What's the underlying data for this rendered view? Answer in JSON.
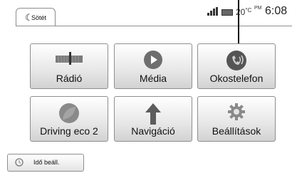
{
  "status_bar": {
    "mode_label": "Sötét",
    "temperature": "20",
    "temperature_unit": "°C",
    "ampm": "PM",
    "time": "6:08"
  },
  "tiles": [
    {
      "label": "Rádió",
      "icon": "radio-icon"
    },
    {
      "label": "Média",
      "icon": "media-play-icon"
    },
    {
      "label": "Okostelefon",
      "icon": "smartphone-icon"
    },
    {
      "label": "Driving eco 2",
      "icon": "eco-leaf-icon"
    },
    {
      "label": "Navigáció",
      "icon": "navigation-arrow-icon"
    },
    {
      "label": "Beállítások",
      "icon": "gear-icon"
    }
  ],
  "bottom_button": {
    "label": "Idő beáll.",
    "icon": "clock-icon"
  }
}
